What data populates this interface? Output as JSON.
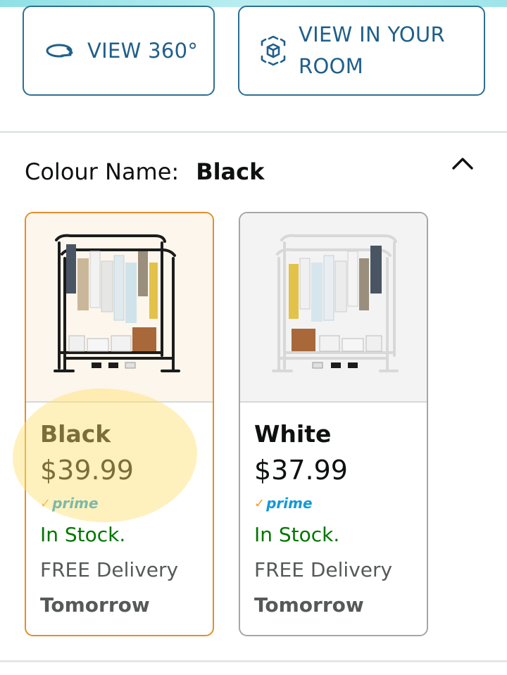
{
  "actions": {
    "view360_label": "VIEW 360°",
    "view360_icon": "rotate-360-icon",
    "room_label": "VIEW IN YOUR ROOM",
    "room_icon": "ar-cube-icon"
  },
  "colour": {
    "label": "Colour Name:",
    "selected": "Black",
    "collapse_icon": "chevron-up-icon"
  },
  "variants": [
    {
      "name": "Black",
      "price": "$39.99",
      "prime": "prime",
      "stock": "In Stock.",
      "delivery": "FREE Delivery",
      "day": "Tomorrow",
      "selected": true
    },
    {
      "name": "White",
      "price": "$37.99",
      "prime": "prime",
      "stock": "In Stock.",
      "delivery": "FREE Delivery",
      "day": "Tomorrow",
      "selected": false
    }
  ],
  "colors": {
    "link": "#1f5f8b",
    "selected_border": "#e38e2a",
    "in_stock": "#007600",
    "prime": "#1399d8",
    "highlight": "#ffe06e"
  }
}
